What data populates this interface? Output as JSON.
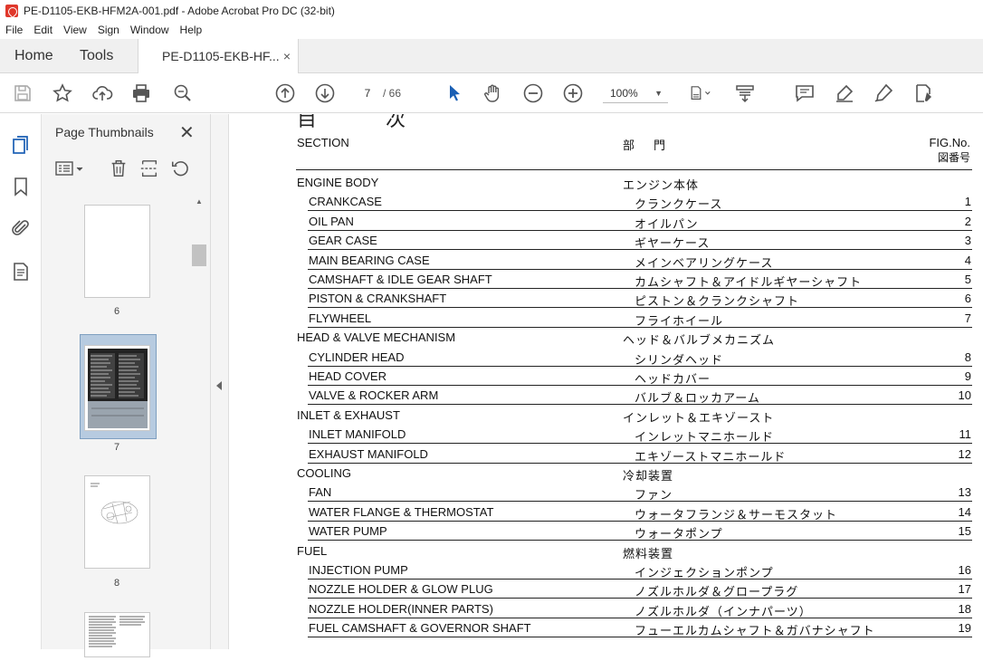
{
  "window": {
    "title": "PE-D1105-EKB-HFM2A-001.pdf - Adobe Acrobat Pro DC (32-bit)"
  },
  "menu": [
    "File",
    "Edit",
    "View",
    "Sign",
    "Window",
    "Help"
  ],
  "tabs": {
    "home": "Home",
    "tools": "Tools",
    "document": "PE-D1105-EKB-HF...",
    "close": "×"
  },
  "toolbar": {
    "current_page": "7",
    "page_total": "/ 66",
    "zoom": "100%"
  },
  "thumbnails": {
    "title": "Page Thumbnails",
    "pages": [
      {
        "label": "6"
      },
      {
        "label": "7",
        "selected": true
      },
      {
        "label": "8"
      }
    ]
  },
  "document": {
    "header_glyphs": [
      "目",
      "次"
    ],
    "columns": {
      "section": "SECTION",
      "dept": "部　門",
      "fig_line1": "FIG.No.",
      "fig_line2": "図番号"
    },
    "groups": [
      {
        "title": "ENGINE BODY",
        "title_jp": "エンジン本体",
        "items": [
          {
            "en": "CRANKCASE",
            "jp": "クランクケース",
            "no": "1"
          },
          {
            "en": "OIL PAN",
            "jp": "オイルパン",
            "no": "2"
          },
          {
            "en": "GEAR CASE",
            "jp": "ギヤーケース",
            "no": "3"
          },
          {
            "en": "MAIN BEARING CASE",
            "jp": "メインベアリングケース",
            "no": "4"
          },
          {
            "en": "CAMSHAFT & IDLE GEAR SHAFT",
            "jp": "カムシャフト＆アイドルギヤーシャフト",
            "no": "5"
          },
          {
            "en": "PISTON & CRANKSHAFT",
            "jp": "ピストン＆クランクシャフト",
            "no": "6"
          },
          {
            "en": "FLYWHEEL",
            "jp": "フライホイール",
            "no": "7"
          }
        ]
      },
      {
        "title": "HEAD & VALVE MECHANISM",
        "title_jp": "ヘッド＆バルブメカニズム",
        "items": [
          {
            "en": "CYLINDER HEAD",
            "jp": "シリンダヘッド",
            "no": "8"
          },
          {
            "en": "HEAD COVER",
            "jp": "ヘッドカバー",
            "no": "9"
          },
          {
            "en": "VALVE & ROCKER ARM",
            "jp": "バルブ＆ロッカアーム",
            "no": "10"
          }
        ]
      },
      {
        "title": "INLET & EXHAUST",
        "title_jp": "インレット＆エキゾースト",
        "items": [
          {
            "en": "INLET MANIFOLD",
            "jp": "インレットマニホールド",
            "no": "11"
          },
          {
            "en": "EXHAUST MANIFOLD",
            "jp": "エキゾーストマニホールド",
            "no": "12"
          }
        ]
      },
      {
        "title": "COOLING",
        "title_jp": "冷却装置",
        "items": [
          {
            "en": "FAN",
            "jp": "ファン",
            "no": "13"
          },
          {
            "en": "WATER FLANGE & THERMOSTAT",
            "jp": "ウォータフランジ＆サーモスタット",
            "no": "14"
          },
          {
            "en": "WATER PUMP",
            "jp": "ウォータポンプ",
            "no": "15"
          }
        ]
      },
      {
        "title": "FUEL",
        "title_jp": "燃料装置",
        "items": [
          {
            "en": "INJECTION PUMP",
            "jp": "インジェクションポンプ",
            "no": "16"
          },
          {
            "en": "NOZZLE HOLDER & GLOW PLUG",
            "jp": "ノズルホルダ＆グロープラグ",
            "no": "17"
          },
          {
            "en": "NOZZLE HOLDER(INNER PARTS)",
            "jp": "ノズルホルダ（インナパーツ）",
            "no": "18"
          },
          {
            "en": "FUEL CAMSHAFT & GOVERNOR SHAFT",
            "jp": "フューエルカムシャフト＆ガバナシャフト",
            "no": "19"
          }
        ]
      }
    ]
  }
}
